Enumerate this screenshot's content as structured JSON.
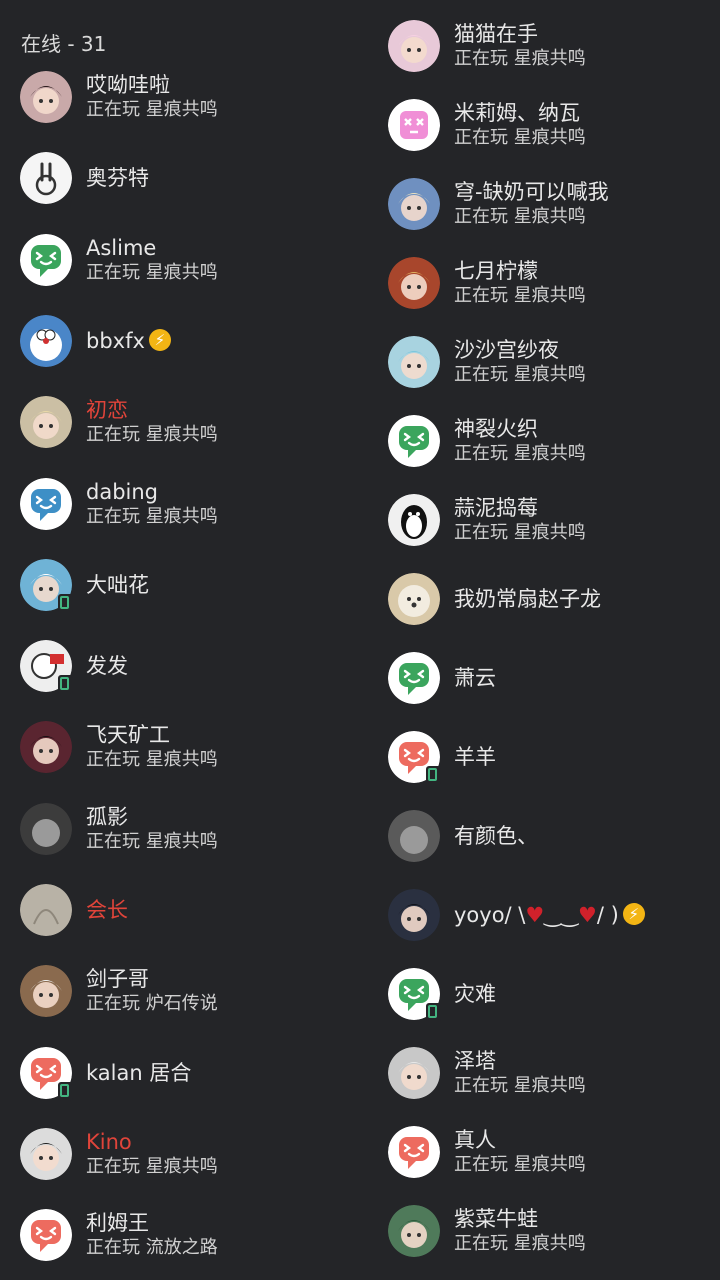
{
  "header": {
    "online_label": "在线 - 31"
  },
  "left": [
    {
      "name": "哎呦哇啦",
      "status": "正在玩 星痕共鸣",
      "avatar": "anime-girl-avatar",
      "color": "#c9a9a9",
      "mobile": false,
      "red": false
    },
    {
      "name": "奥芬特",
      "status": "",
      "avatar": "bunny-avatar",
      "color": "#f5f5f5",
      "mobile": false,
      "red": false
    },
    {
      "name": "Aslime",
      "status": "正在玩 星痕共鸣",
      "avatar": "default-green-avatar",
      "color": "#3ba55d",
      "mobile": false,
      "red": false
    },
    {
      "name": "bbxfx",
      "status": "",
      "avatar": "doraemon-avatar",
      "color": "#4a86c8",
      "mobile": false,
      "red": false,
      "nitro": true
    },
    {
      "name": "初恋",
      "status": "正在玩 星痕共鸣",
      "avatar": "anime-blonde-avatar",
      "color": "#cbbfa4",
      "mobile": false,
      "red": true
    },
    {
      "name": "dabing",
      "status": "正在玩 星痕共鸣",
      "avatar": "default-blue-avatar",
      "color": "#3d8fc6",
      "mobile": false,
      "red": false
    },
    {
      "name": "大咄花",
      "status": "",
      "avatar": "cartoon-cat-avatar",
      "color": "#6fb3d6",
      "mobile": true,
      "red": false
    },
    {
      "name": "发发",
      "status": "",
      "avatar": "sticker-avatar",
      "color": "#eeeeee",
      "mobile": true,
      "red": false
    },
    {
      "name": "飞天矿工",
      "status": "正在玩 星痕共鸣",
      "avatar": "dark-anime-avatar",
      "color": "#5a2530",
      "mobile": false,
      "red": false
    },
    {
      "name": "孤影",
      "status": "正在玩 星痕共鸣",
      "avatar": "monochrome-avatar",
      "color": "#3c3c3c",
      "mobile": false,
      "red": false
    },
    {
      "name": "会长",
      "status": "",
      "avatar": "sketch-avatar",
      "color": "#b8b2a6",
      "mobile": false,
      "red": true
    },
    {
      "name": "剑子哥",
      "status": "正在玩 炉石传说",
      "avatar": "framed-anime-avatar",
      "color": "#8a6a4e",
      "mobile": false,
      "red": false
    },
    {
      "name": "kalan 居合",
      "status": "",
      "avatar": "default-red-avatar",
      "color": "#ed6b5f",
      "mobile": true,
      "red": false
    },
    {
      "name": "Kino",
      "status": "正在玩 星痕共鸣",
      "avatar": "anime-boy-avatar",
      "color": "#dcdcdc",
      "mobile": false,
      "red": true
    },
    {
      "name": "利姆王",
      "status": "正在玩 流放之路",
      "avatar": "default-red-avatar",
      "color": "#ed6b5f",
      "mobile": false,
      "red": false
    }
  ],
  "right": [
    {
      "name": "猫猫在手",
      "status": "正在玩 星痕共鸣",
      "avatar": "anime-pink-avatar",
      "color": "#e8c9d8",
      "mobile": false,
      "red": false
    },
    {
      "name": "米莉姆、纳瓦",
      "status": "正在玩 星痕共鸣",
      "avatar": "pink-face-avatar",
      "color": "#f08fd6",
      "mobile": false,
      "red": false
    },
    {
      "name": "穹-缺奶可以喊我",
      "status": "正在玩 星痕共鸣",
      "avatar": "anime-blue-avatar",
      "color": "#6f90c0",
      "mobile": false,
      "red": false
    },
    {
      "name": "七月柠檬",
      "status": "正在玩 星痕共鸣",
      "avatar": "anime-red-avatar",
      "color": "#a8462c",
      "mobile": false,
      "red": false
    },
    {
      "name": "沙沙宫纱夜",
      "status": "正在玩 星痕共鸣",
      "avatar": "anime-cyan-avatar",
      "color": "#a8d3e0",
      "mobile": false,
      "red": false
    },
    {
      "name": "神裂火织",
      "status": "正在玩 星痕共鸣",
      "avatar": "default-green-avatar",
      "color": "#3ba55d",
      "mobile": false,
      "red": false
    },
    {
      "name": "蒜泥捣莓",
      "status": "正在玩 星痕共鸣",
      "avatar": "penguin-avatar",
      "color": "#f0f0f0",
      "mobile": false,
      "red": false
    },
    {
      "name": "我奶常扇赵子龙",
      "status": "",
      "avatar": "dog-avatar",
      "color": "#d9c9a9",
      "mobile": false,
      "red": false
    },
    {
      "name": "萧云",
      "status": "",
      "avatar": "default-green-avatar",
      "color": "#3ba55d",
      "mobile": false,
      "red": false
    },
    {
      "name": "羊羊",
      "status": "",
      "avatar": "default-red-avatar",
      "color": "#ed6b5f",
      "mobile": true,
      "red": false
    },
    {
      "name": "有颜色、",
      "status": "",
      "avatar": "gray-avatar",
      "color": "#5a5a5a",
      "mobile": false,
      "red": false
    },
    {
      "name": "yoyo/ \\",
      "status": "",
      "avatar": "dark-boy-avatar",
      "color": "#2a3040",
      "mobile": false,
      "red": false,
      "kaomoji": true,
      "nitro": true
    },
    {
      "name": "灾难",
      "status": "",
      "avatar": "default-green-avatar",
      "color": "#3ba55d",
      "mobile": true,
      "red": false
    },
    {
      "name": "泽塔",
      "status": "正在玩 星痕共鸣",
      "avatar": "anime-gray-avatar",
      "color": "#c8c8c8",
      "mobile": false,
      "red": false
    },
    {
      "name": "真人",
      "status": "正在玩 星痕共鸣",
      "avatar": "default-red-avatar",
      "color": "#ed6b5f",
      "mobile": false,
      "red": false
    },
    {
      "name": "紫菜牛蛙",
      "status": "正在玩 星痕共鸣",
      "avatar": "anime-green-avatar",
      "color": "#4f7a5a",
      "mobile": false,
      "red": false
    }
  ],
  "kaomoji": {
    "heart1": "♥",
    "mouth": "‿‿",
    "heart2": "♥",
    "tail": "/ )"
  },
  "nitro_glyph": "⚡"
}
